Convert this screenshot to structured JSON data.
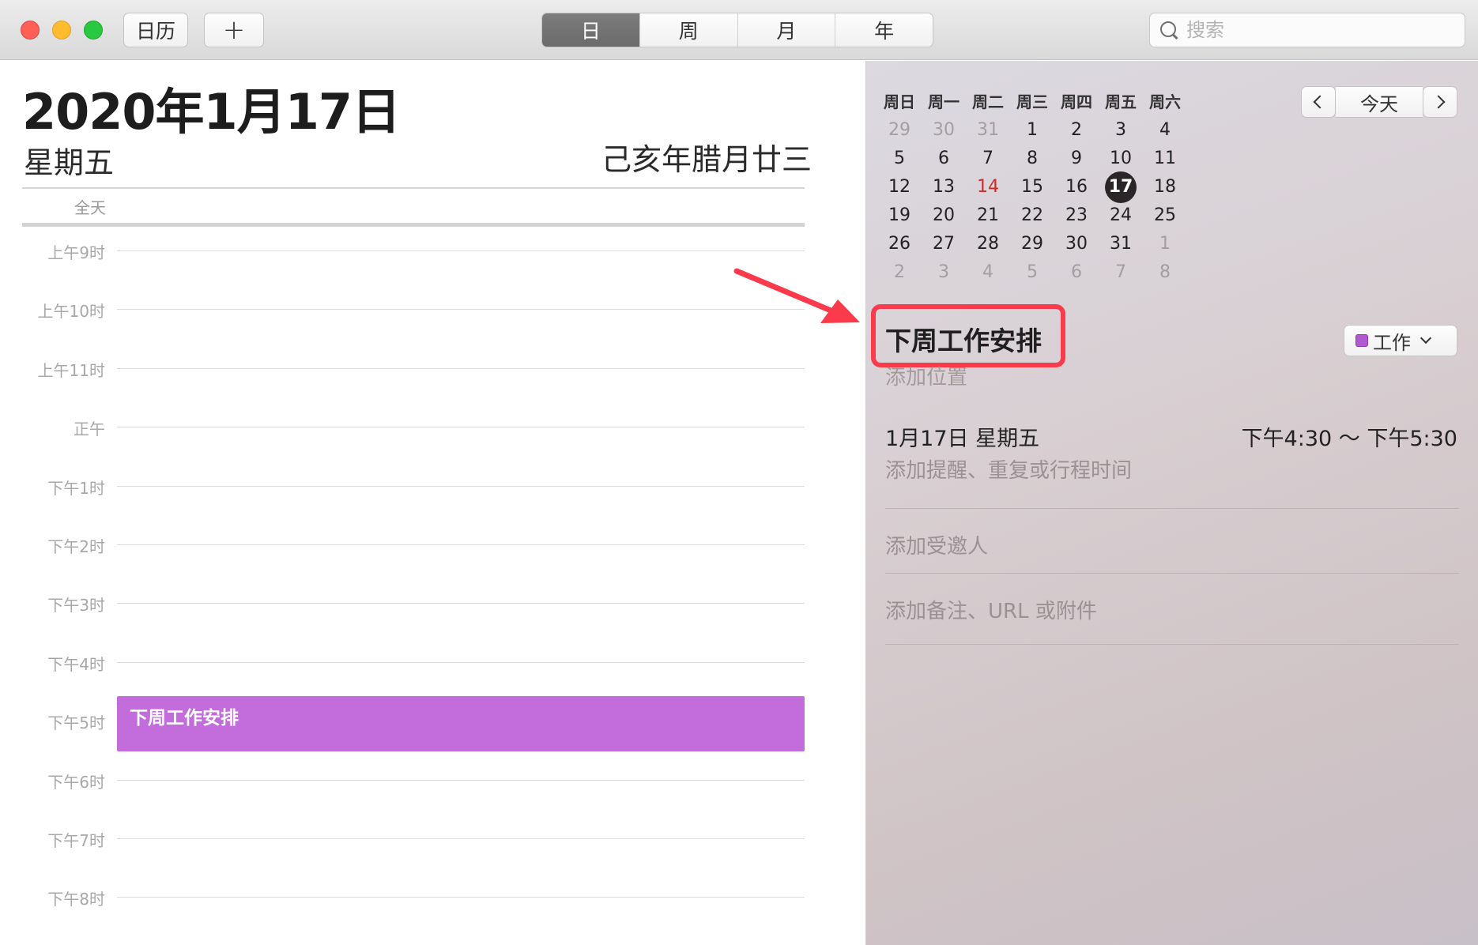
{
  "toolbar": {
    "calendars_button": "日历",
    "add_button": "+",
    "views": [
      "日",
      "周",
      "月",
      "年"
    ],
    "active_view": 0,
    "search_placeholder": "搜索"
  },
  "day_view": {
    "date_title": "2020年1月17日",
    "weekday": "星期五",
    "lunar_date": "己亥年腊月廿三",
    "all_day_label": "全天",
    "hours": [
      "上午9时",
      "上午10时",
      "上午11时",
      "正午",
      "下午1时",
      "下午2时",
      "下午3时",
      "下午4时",
      "下午5时",
      "下午6时",
      "下午7时",
      "下午8时"
    ],
    "event_title": "下周工作安排"
  },
  "mini_calendar": {
    "weekday_headers": [
      "周日",
      "周一",
      "周二",
      "周三",
      "周四",
      "周五",
      "周六"
    ],
    "weeks": [
      [
        "29",
        "30",
        "31",
        "1",
        "2",
        "3",
        "4"
      ],
      [
        "5",
        "6",
        "7",
        "8",
        "9",
        "10",
        "11"
      ],
      [
        "12",
        "13",
        "14",
        "15",
        "16",
        "17",
        "18"
      ],
      [
        "19",
        "20",
        "21",
        "22",
        "23",
        "24",
        "25"
      ],
      [
        "26",
        "27",
        "28",
        "29",
        "30",
        "31",
        "1"
      ],
      [
        "2",
        "3",
        "4",
        "5",
        "6",
        "7",
        "8"
      ]
    ],
    "today_day": "14",
    "selected_day": "17",
    "today_button": "今天",
    "colors": {
      "today": "#cf2a2a",
      "selected_bg": "#2a2527"
    }
  },
  "event_detail": {
    "title": "下周工作安排",
    "add_location": "添加位置",
    "calendar_name": "工作",
    "calendar_color": "#b05ad1",
    "date": "1月17日 星期五",
    "time": "下午4:30 ～ 下午5:30",
    "add_reminder": "添加提醒、重复或行程时间",
    "add_invitees": "添加受邀人",
    "add_notes": "添加备注、URL 或附件"
  },
  "annotation": {
    "highlight_color": "#fb3a4c"
  }
}
